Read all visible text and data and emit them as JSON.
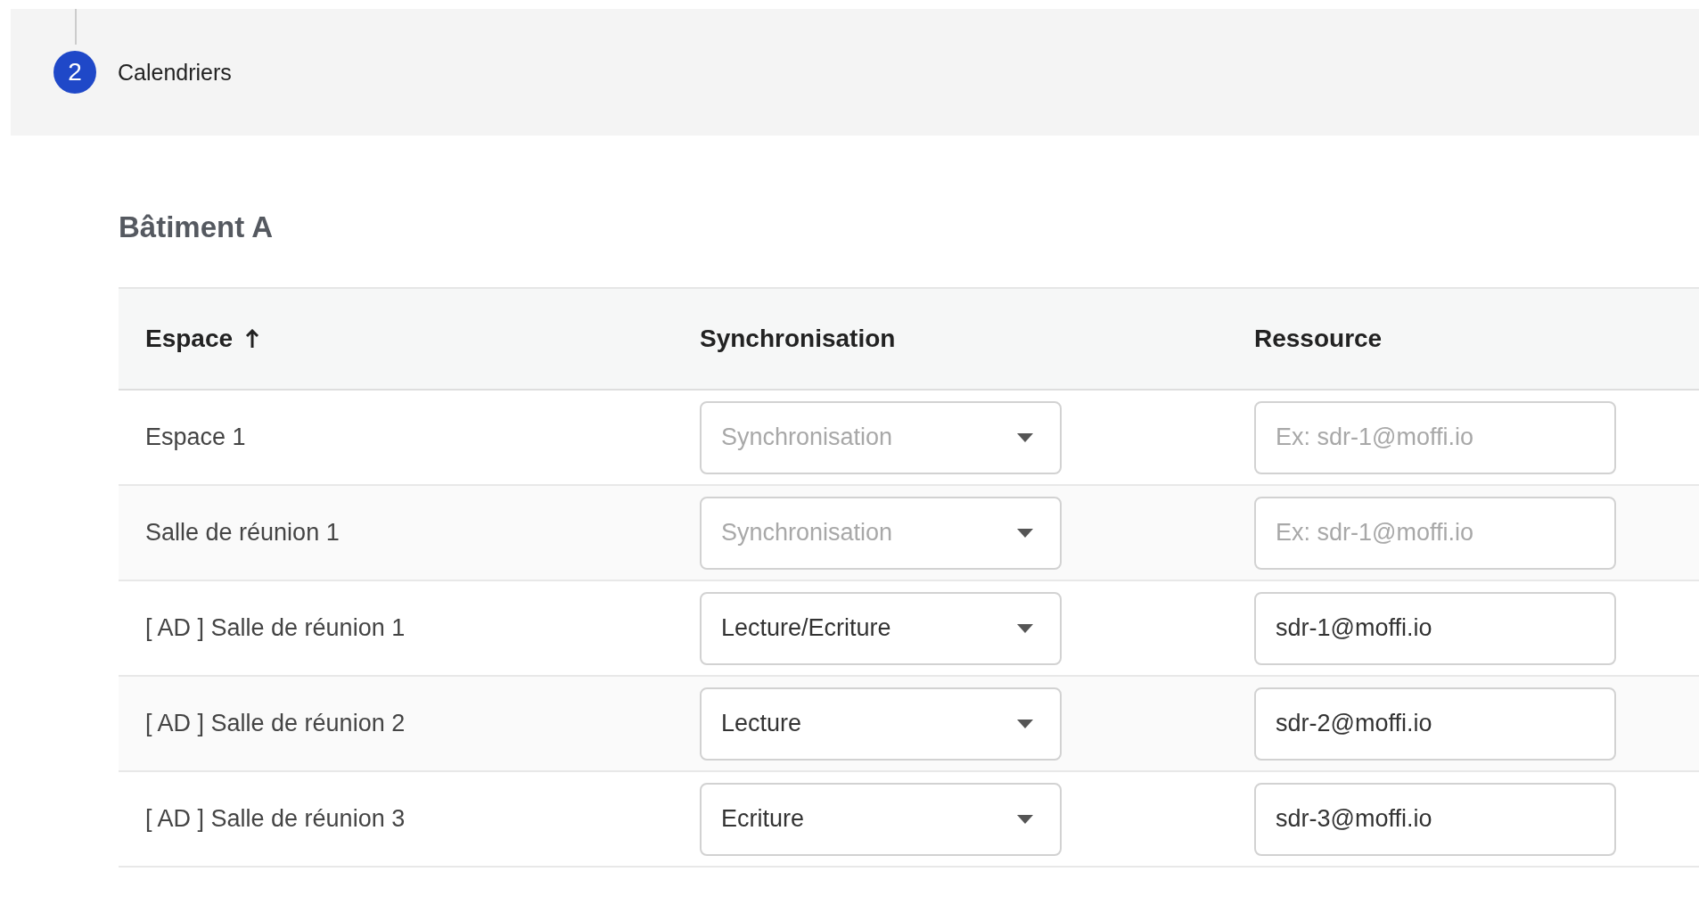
{
  "step": {
    "number": "2",
    "label": "Calendriers"
  },
  "section_title": "Bâtiment A",
  "table": {
    "columns": [
      {
        "label": "Espace",
        "sorted": true
      },
      {
        "label": "Synchronisation",
        "sorted": false
      },
      {
        "label": "Ressource",
        "sorted": false
      }
    ],
    "rows": [
      {
        "space": "Espace 1",
        "sync": {
          "placeholder": "Synchronisation"
        },
        "resource": {
          "placeholder": "Ex: sdr-1@moffi.io"
        }
      },
      {
        "space": "Salle de réunion 1",
        "sync": {
          "placeholder": "Synchronisation"
        },
        "resource": {
          "placeholder": "Ex: sdr-1@moffi.io"
        }
      },
      {
        "space": "[ AD ] Salle de réunion 1",
        "sync": {
          "value": "Lecture/Ecriture"
        },
        "resource": {
          "value": "sdr-1@moffi.io"
        }
      },
      {
        "space": "[ AD ] Salle de réunion 2",
        "sync": {
          "value": "Lecture"
        },
        "resource": {
          "value": "sdr-2@moffi.io"
        }
      },
      {
        "space": "[ AD ] Salle de réunion 3",
        "sync": {
          "value": "Ecriture"
        },
        "resource": {
          "value": "sdr-3@moffi.io"
        }
      }
    ]
  }
}
